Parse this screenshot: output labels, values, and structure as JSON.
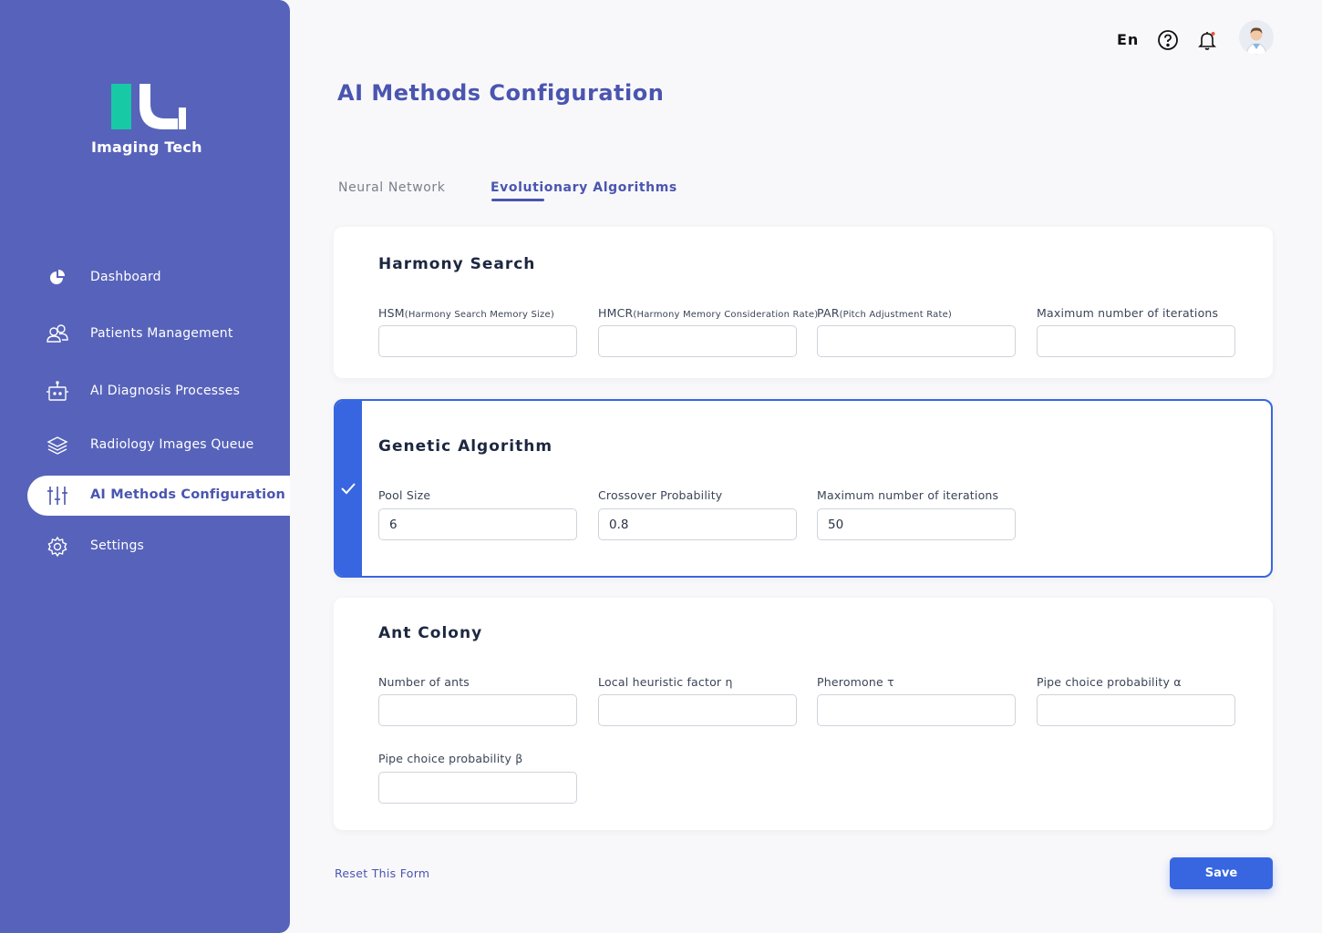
{
  "brand": {
    "name": "Imaging Tech",
    "logo_colors": {
      "teal": "#17c9a5",
      "white": "#ffffff"
    }
  },
  "colors": {
    "sidebar": "#5763ba",
    "accent": "#4a55b0",
    "primary_button": "#3766e0"
  },
  "sidebar": {
    "items": [
      {
        "label": "Dashboard",
        "icon": "pie-chart-icon"
      },
      {
        "label": "Patients Management",
        "icon": "users-icon"
      },
      {
        "label": "AI Diagnosis Processes",
        "icon": "robot-icon"
      },
      {
        "label": "Radiology Images Queue",
        "icon": "layers-icon"
      },
      {
        "label": "AI Methods Configuration",
        "icon": "sliders-icon",
        "active": true
      },
      {
        "label": "Settings",
        "icon": "gear-icon"
      }
    ]
  },
  "header": {
    "language": "En",
    "icons": [
      "help-icon",
      "bell-icon"
    ],
    "avatar": "user-avatar"
  },
  "page": {
    "title": "AI Methods Configuration"
  },
  "tabs": [
    {
      "label": "Neural Network",
      "active": false
    },
    {
      "label": "Evolutionary Algorithms",
      "active": true
    }
  ],
  "harmony_search": {
    "title": "Harmony Search",
    "fields": [
      {
        "label": "HSM",
        "sub": "(Harmony Search Memory Size)",
        "value": ""
      },
      {
        "label": "HMCR",
        "sub": "(Harmony Memory Consideration Rate)",
        "value": ""
      },
      {
        "label": "PAR",
        "sub": "(Pitch Adjustment Rate)",
        "value": ""
      },
      {
        "label": "Maximum number of iterations",
        "sub": "",
        "value": ""
      }
    ]
  },
  "genetic_algorithm": {
    "title": "Genetic Algorithm",
    "selected": true,
    "fields": [
      {
        "label": "Pool Size",
        "value": "6"
      },
      {
        "label": "Crossover Probability",
        "value": "0.8"
      },
      {
        "label": "Maximum number of iterations",
        "value": "50"
      }
    ]
  },
  "ant_colony": {
    "title": "Ant Colony",
    "fields": [
      {
        "label": "Number of ants",
        "value": ""
      },
      {
        "label": "Local heuristic factor η",
        "value": ""
      },
      {
        "label": "Pheromone τ",
        "value": ""
      },
      {
        "label": "Pipe choice probability α",
        "value": ""
      },
      {
        "label": "Pipe choice probability β",
        "value": ""
      }
    ]
  },
  "footer": {
    "reset_label": "Reset This Form",
    "save_label": "Save"
  }
}
